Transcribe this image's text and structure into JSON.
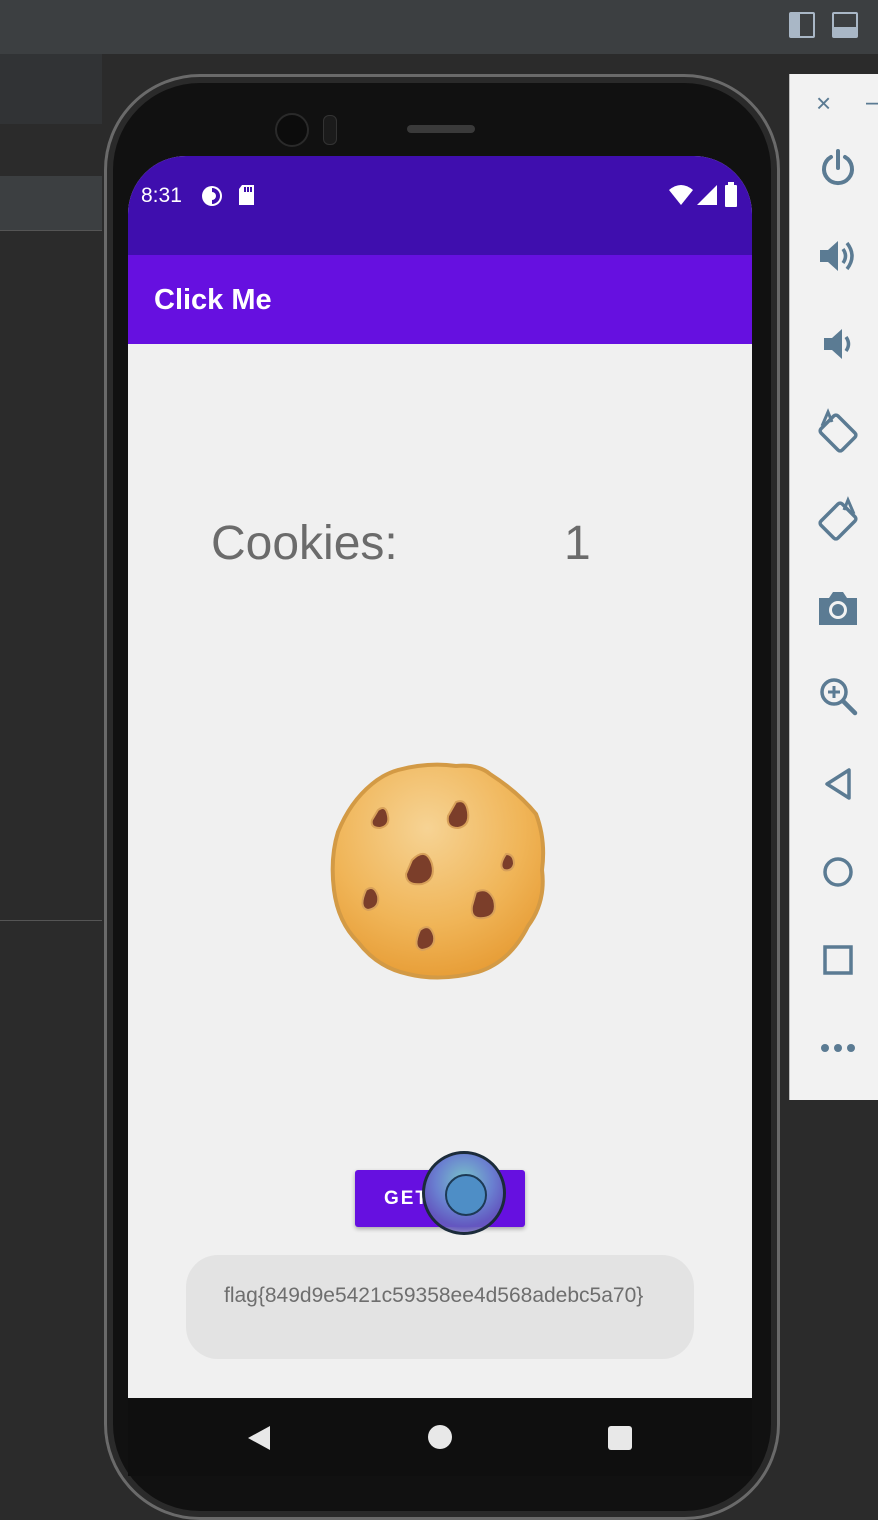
{
  "app": {
    "title": "Click Me",
    "status_time": "8:31",
    "cookies_label": "Cookies:",
    "cookies_count": "1",
    "get_flag_label": "GET FLAG",
    "flag_text": "flag{849d9e5421c59358ee4d568adebc5a70}"
  },
  "emulator_toolbar": {
    "close_label": "×",
    "minimize_label": "–",
    "buttons": [
      "power-icon",
      "volume-up-icon",
      "volume-down-icon",
      "rotate-left-icon",
      "rotate-right-icon",
      "camera-icon",
      "zoom-icon",
      "back-icon",
      "home-icon",
      "overview-icon",
      "more-icon"
    ]
  },
  "colors": {
    "status_bar": "#3f0eae",
    "app_bar": "#6610e0",
    "screen_bg": "#f0f0f0",
    "icon_color": "#5b7b93"
  }
}
